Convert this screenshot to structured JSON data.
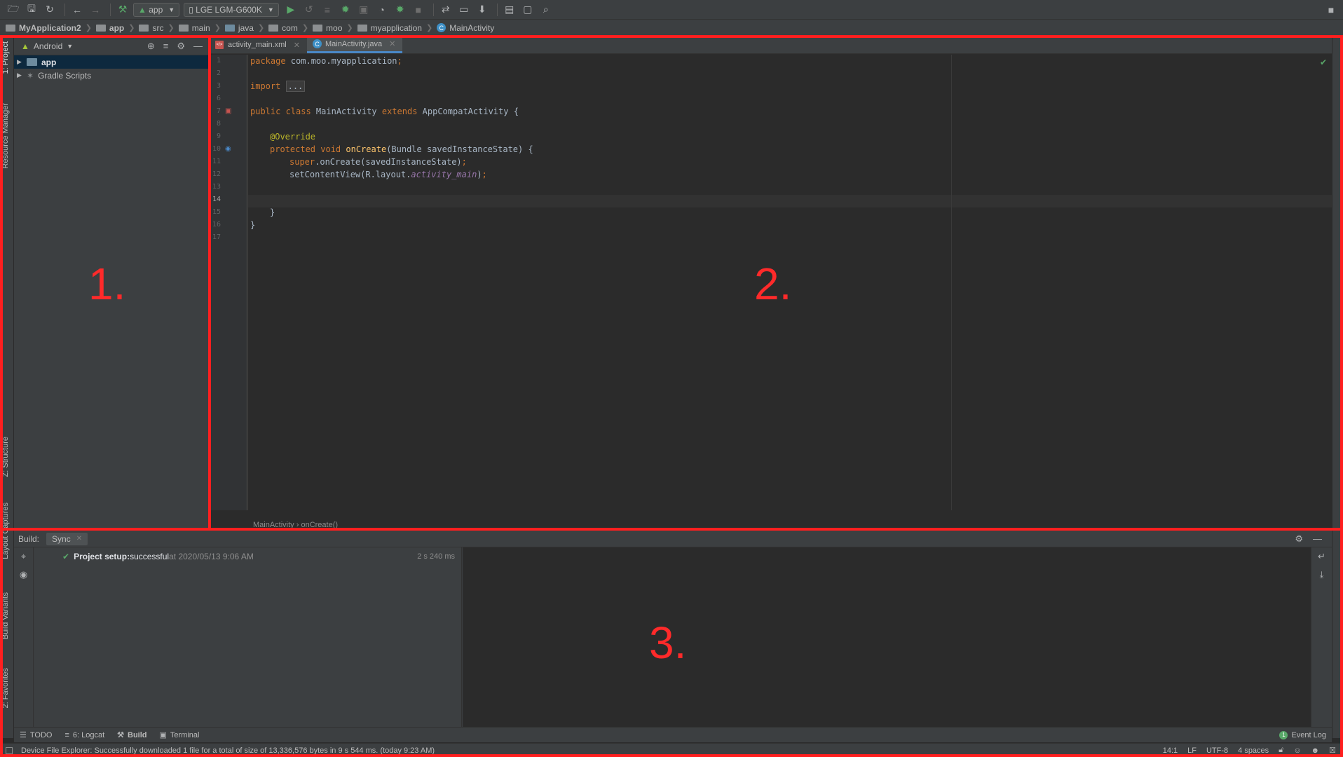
{
  "toolbar": {
    "run_config": "app",
    "device": "LGE LGM-G600K"
  },
  "breadcrumb": [
    "MyApplication2",
    "app",
    "src",
    "main",
    "java",
    "com",
    "moo",
    "myapplication",
    "MainActivity"
  ],
  "project_panel": {
    "view_mode": "Android",
    "tree": [
      {
        "label": "app",
        "selected": true
      },
      {
        "label": "Gradle Scripts",
        "selected": false
      }
    ]
  },
  "left_strip": {
    "project": "1: Project",
    "resource_manager": "Resource Manager",
    "structure": "Z: Structure",
    "layout_captures": "Layout Captures",
    "build_variants": "Build Variants",
    "favorites": "2: Favorites"
  },
  "editor": {
    "tabs": [
      {
        "label": "activity_main.xml",
        "active": false
      },
      {
        "label": "MainActivity.java",
        "active": true
      }
    ],
    "line_numbers": [
      "1",
      "2",
      "3",
      "6",
      "7",
      "8",
      "9",
      "10",
      "11",
      "12",
      "13",
      "14",
      "15",
      "16",
      "17"
    ],
    "lines": {
      "l1_kw": "package",
      "l1_rest": " com.moo.myapplication",
      "l1_semi": ";",
      "l3_kw": "import",
      "l3_fold": "...",
      "l7_kw": "public class",
      "l7_name": " MainActivity ",
      "l7_kw2": "extends",
      "l7_rest": " AppCompatActivity {",
      "l9_ann": "@Override",
      "l10_kw": "protected void",
      "l10_fn": " onCreate",
      "l10_rest": "(Bundle savedInstanceState) {",
      "l11_kw": "super",
      "l11_rest": ".onCreate(savedInstanceState)",
      "l11_semi": ";",
      "l12_a": "setContentView(R.layout.",
      "l12_it": "activity_main",
      "l12_b": ")",
      "l12_semi": ";",
      "l15": "}",
      "l16": "}"
    },
    "crumb": "MainActivity  ›  onCreate()"
  },
  "build": {
    "label": "Build:",
    "tab": "Sync",
    "row_bold": "Project setup:",
    "row_status": " successful",
    "row_at": " at 2020/05/13 9:06 AM",
    "row_time": "2 s 240 ms"
  },
  "toolwindows": [
    {
      "label": "TODO"
    },
    {
      "label": "6: Logcat"
    },
    {
      "label": "Build"
    },
    {
      "label": "Terminal"
    }
  ],
  "event_log": {
    "count": "1",
    "label": "Event Log"
  },
  "status": {
    "message": "Device File Explorer: Successfully downloaded 1 file for a total of size of 13,336,576 bytes in 9 s 544 ms. (today 9:23 AM)",
    "position": "14:1",
    "line_sep": "LF",
    "encoding": "UTF-8",
    "indent": "4 spaces"
  },
  "annotations": [
    "1.",
    "2.",
    "3."
  ],
  "colors": {
    "accent": "#4a88c7",
    "success": "#59a869",
    "annotation": "#ff1f1f"
  }
}
